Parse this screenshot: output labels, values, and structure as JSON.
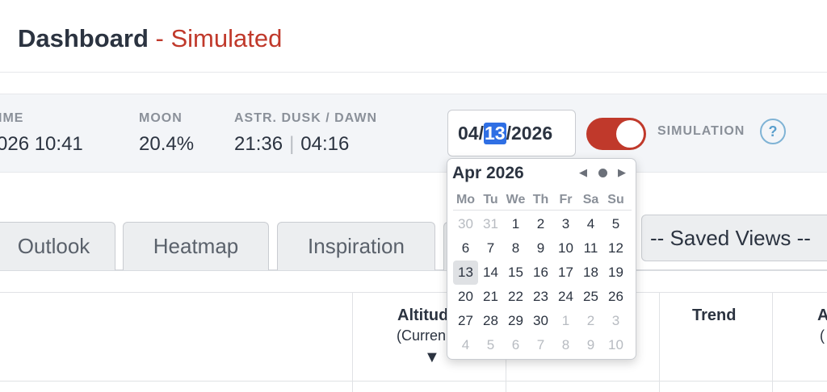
{
  "header": {
    "title_main": "Dashboard",
    "title_sep": " - ",
    "title_mode": "Simulated"
  },
  "info": {
    "time_label": "IME",
    "time_value": "026  10:41",
    "moon_label": "MOON",
    "moon_value": "20.4%",
    "dusk_label": "ASTR. DUSK / DAWN",
    "dusk_value": "21:36",
    "dusk_sep": "|",
    "dawn_value": "04:16"
  },
  "date_input": {
    "month": "04",
    "sep1": "/",
    "day": "13",
    "sep2": "/",
    "year": "2026"
  },
  "simulation": {
    "label": "SIMULATION",
    "enabled": true,
    "help_glyph": "?"
  },
  "tabs": [
    {
      "label": "Outlook"
    },
    {
      "label": "Heatmap"
    },
    {
      "label": "Inspiration"
    }
  ],
  "saved_views": {
    "selected": "-- Saved Views --"
  },
  "table": {
    "headers": [
      {
        "label": "Altitud",
        "sub": "(Curren"
      },
      {
        "label": "Trend",
        "sub": ""
      },
      {
        "label": "A",
        "sub": "("
      }
    ],
    "sort_glyph": "▼"
  },
  "calendar": {
    "title": "Apr 2026",
    "prev_glyph": "◀",
    "next_glyph": "▶",
    "weekdays": [
      "Mo",
      "Tu",
      "We",
      "Th",
      "Fr",
      "Sa",
      "Su"
    ],
    "days": [
      {
        "d": "30",
        "muted": true
      },
      {
        "d": "31",
        "muted": true
      },
      {
        "d": "1"
      },
      {
        "d": "2"
      },
      {
        "d": "3"
      },
      {
        "d": "4"
      },
      {
        "d": "5"
      },
      {
        "d": "6"
      },
      {
        "d": "7"
      },
      {
        "d": "8"
      },
      {
        "d": "9"
      },
      {
        "d": "10"
      },
      {
        "d": "11"
      },
      {
        "d": "12"
      },
      {
        "d": "13",
        "selected": true
      },
      {
        "d": "14"
      },
      {
        "d": "15"
      },
      {
        "d": "16"
      },
      {
        "d": "17"
      },
      {
        "d": "18"
      },
      {
        "d": "19"
      },
      {
        "d": "20"
      },
      {
        "d": "21"
      },
      {
        "d": "22"
      },
      {
        "d": "23"
      },
      {
        "d": "24"
      },
      {
        "d": "25"
      },
      {
        "d": "26"
      },
      {
        "d": "27"
      },
      {
        "d": "28"
      },
      {
        "d": "29"
      },
      {
        "d": "30"
      },
      {
        "d": "1",
        "muted": true
      },
      {
        "d": "2",
        "muted": true
      },
      {
        "d": "3",
        "muted": true
      },
      {
        "d": "4",
        "muted": true
      },
      {
        "d": "5",
        "muted": true
      },
      {
        "d": "6",
        "muted": true
      },
      {
        "d": "7",
        "muted": true
      },
      {
        "d": "8",
        "muted": true
      },
      {
        "d": "9",
        "muted": true
      },
      {
        "d": "10",
        "muted": true
      }
    ]
  },
  "colors": {
    "accent_red": "#c0392b",
    "selection_blue": "#2f6fe4",
    "help_blue": "#5b9fcc"
  }
}
